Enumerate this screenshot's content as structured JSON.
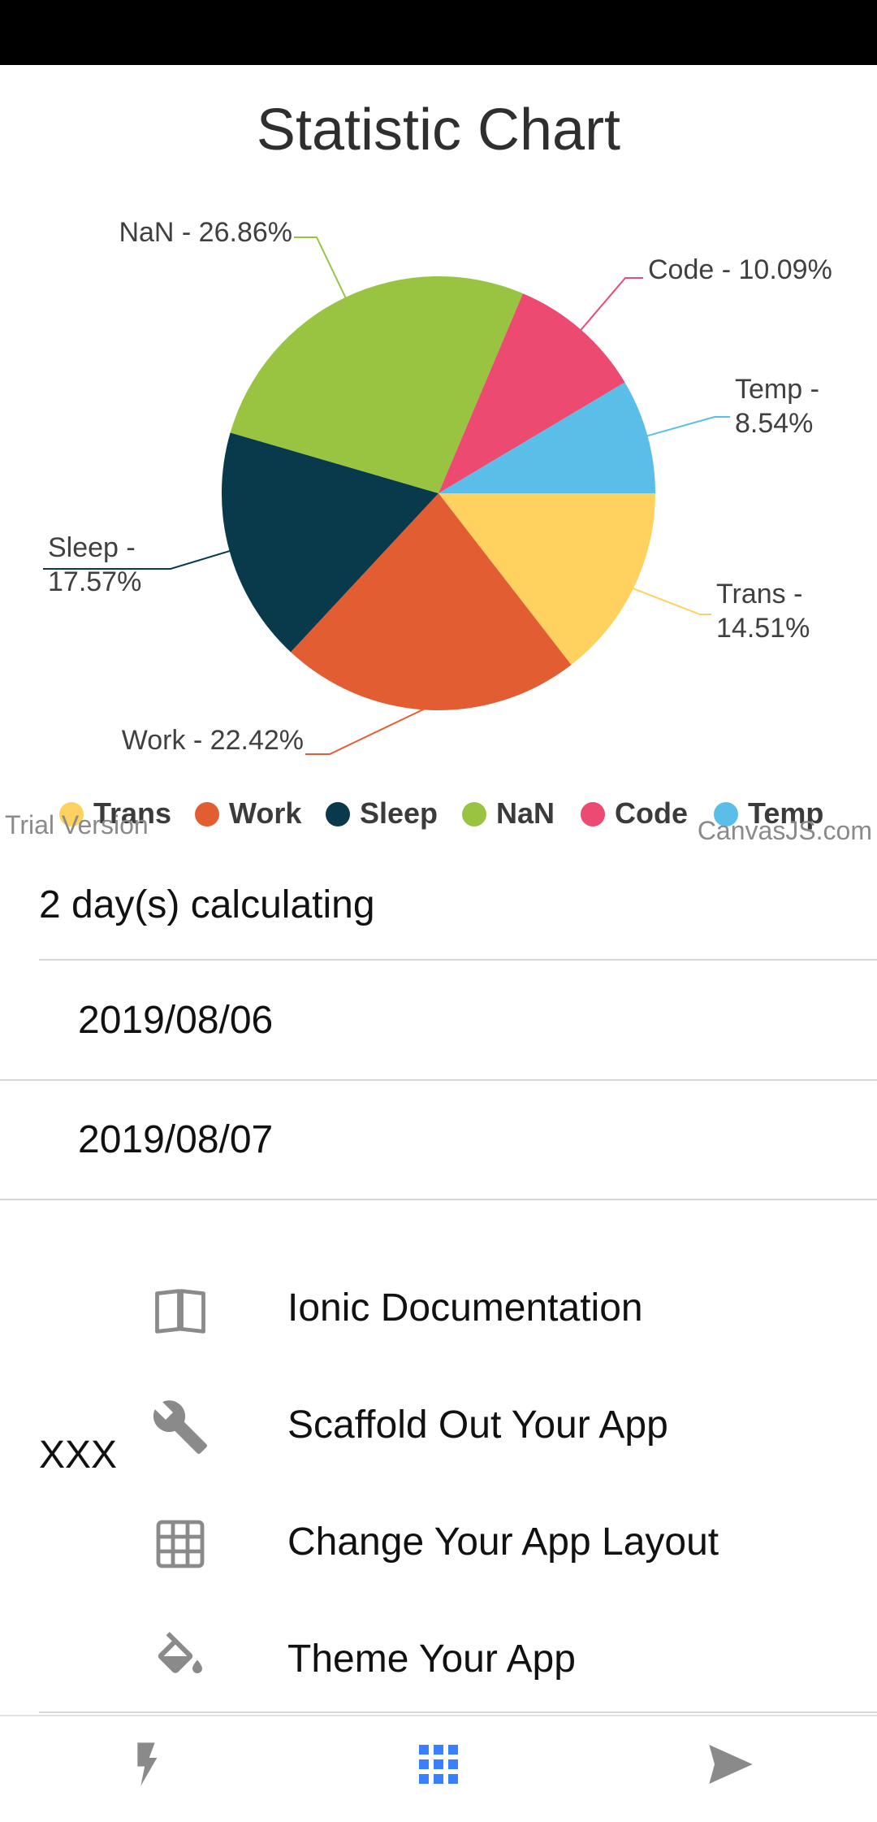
{
  "chart_data": {
    "type": "pie",
    "title": "Statistic Chart",
    "slices": [
      {
        "name": "Trans",
        "value": 14.51,
        "label": "Trans - 14.51%",
        "color": "#FFD15E"
      },
      {
        "name": "Work",
        "value": 22.42,
        "label": "Work - 22.42%",
        "color": "#E35D33"
      },
      {
        "name": "Sleep",
        "value": 17.57,
        "label": "Sleep - 17.57%",
        "color": "#093A4C"
      },
      {
        "name": "NaN",
        "value": 26.86,
        "label": "NaN - 26.86%",
        "color": "#99C441"
      },
      {
        "name": "Code",
        "value": 10.09,
        "label": "Code - 10.09%",
        "color": "#EC4A71"
      },
      {
        "name": "Temp",
        "value": 8.54,
        "label": "Temp - 8.54%",
        "color": "#5BBEE9"
      }
    ],
    "legend": [
      "Trans",
      "Work",
      "Sleep",
      "NaN",
      "Code",
      "Temp"
    ],
    "legend_placement": "bottom",
    "credits": {
      "left": "Trial Version",
      "right": "CanvasJS.com"
    }
  },
  "summary": {
    "days_text": "2 day(s) calculating"
  },
  "dates": [
    "2019/08/06",
    "2019/08/07"
  ],
  "menu": {
    "label": "XXX",
    "items": [
      {
        "label": "Ionic Documentation",
        "icon": "book-icon"
      },
      {
        "label": "Scaffold Out Your App",
        "icon": "wrench-icon"
      },
      {
        "label": "Change Your App Layout",
        "icon": "grid-icon"
      },
      {
        "label": "Theme Your App",
        "icon": "paint-bucket-icon"
      }
    ]
  },
  "tabs": [
    {
      "icon": "flash-icon",
      "color": "#8a8a8a"
    },
    {
      "icon": "apps-icon",
      "color": "#3880ff"
    },
    {
      "icon": "send-icon",
      "color": "#8a8a8a"
    }
  ]
}
